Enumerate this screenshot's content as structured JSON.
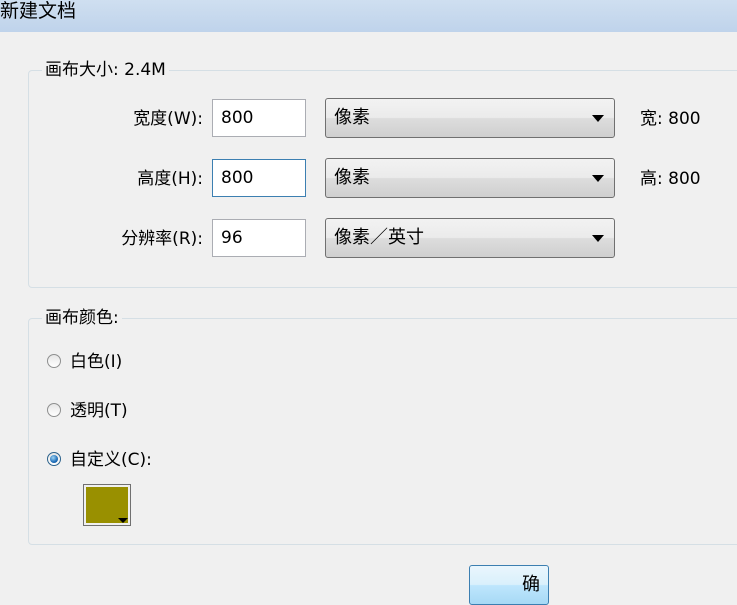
{
  "window": {
    "title": "新建文档"
  },
  "canvas_size": {
    "legend": "画布大小: 2.4M",
    "rows": [
      {
        "label": "宽度(W):",
        "value": "800",
        "unit": "像素",
        "side": "宽: 800"
      },
      {
        "label": "高度(H):",
        "value": "800",
        "unit": "像素",
        "side": "高: 800"
      },
      {
        "label": "分辨率(R):",
        "value": "96",
        "unit": "像素／英寸",
        "side": ""
      }
    ]
  },
  "canvas_color": {
    "legend": "画布颜色:",
    "options": [
      {
        "label": "白色(I)",
        "checked": false
      },
      {
        "label": "透明(T)",
        "checked": false
      },
      {
        "label": "自定义(C):",
        "checked": true
      }
    ],
    "custom_color": "#999000"
  },
  "buttons": {
    "ok": "确"
  }
}
